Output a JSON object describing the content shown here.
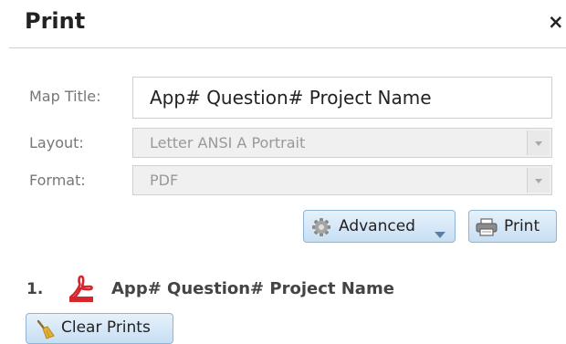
{
  "dialog": {
    "title": "Print",
    "close_symbol": "×"
  },
  "form": {
    "map_title_label": "Map Title:",
    "map_title_value": "App# Question# Project Name",
    "layout_label": "Layout:",
    "layout_value": "Letter ANSI A Portrait",
    "format_label": "Format:",
    "format_value": "PDF"
  },
  "buttons": {
    "advanced": "Advanced",
    "print": "Print",
    "clear_prints": "Clear Prints"
  },
  "prints": [
    {
      "index": "1.",
      "name": "App# Question# Project Name",
      "icon": "pdf-icon"
    }
  ],
  "colors": {
    "button_border": "#8fb5d6",
    "button_top": "#e6f1fb",
    "button_bottom": "#c7dff3",
    "pdf_red": "#d7262b"
  }
}
